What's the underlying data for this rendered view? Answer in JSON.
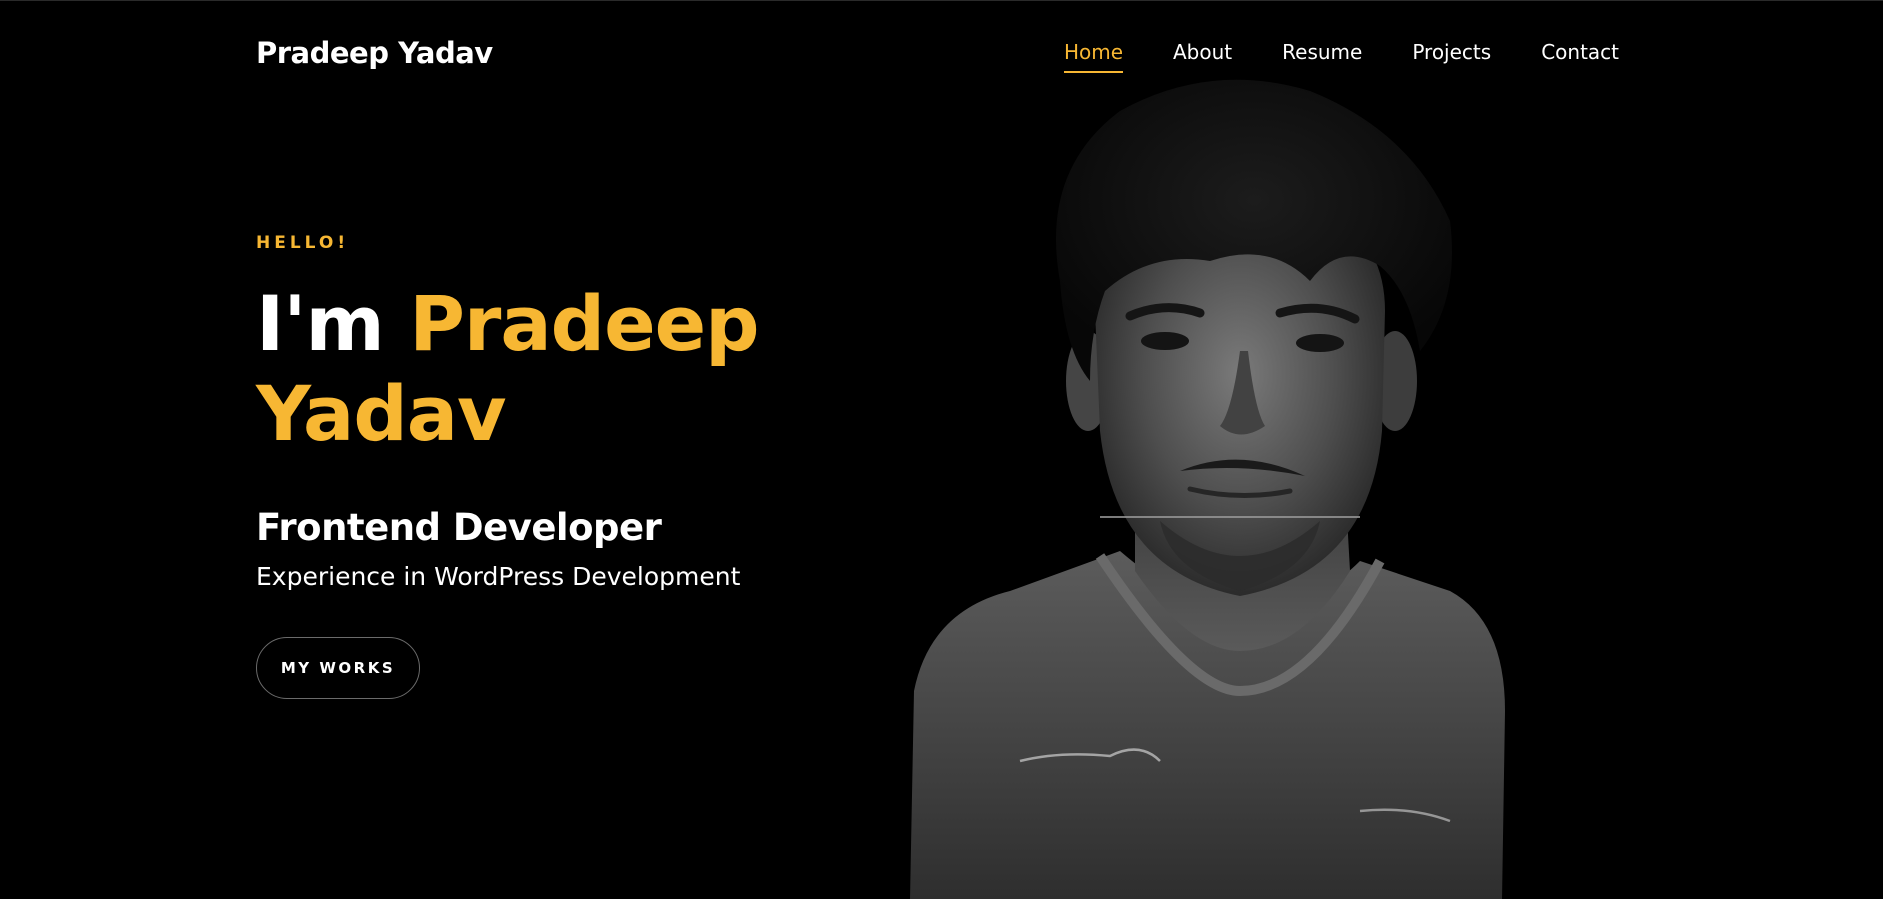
{
  "header": {
    "brand": "Pradeep Yadav",
    "nav": [
      {
        "label": "Home",
        "active": true
      },
      {
        "label": "About",
        "active": false
      },
      {
        "label": "Resume",
        "active": false
      },
      {
        "label": "Projects",
        "active": false
      },
      {
        "label": "Contact",
        "active": false
      }
    ]
  },
  "hero": {
    "greeting": "HELLO!",
    "headline_intro": "I'm",
    "headline_name_first": "Pradeep",
    "headline_name_last": "Yadav",
    "role": "Frontend Developer",
    "subtitle": "Experience in WordPress Development",
    "cta_label": "MY WORKS"
  },
  "colors": {
    "background": "#000000",
    "accent": "#f7b733",
    "text": "#ffffff",
    "button_border": "#6b6b6b"
  }
}
